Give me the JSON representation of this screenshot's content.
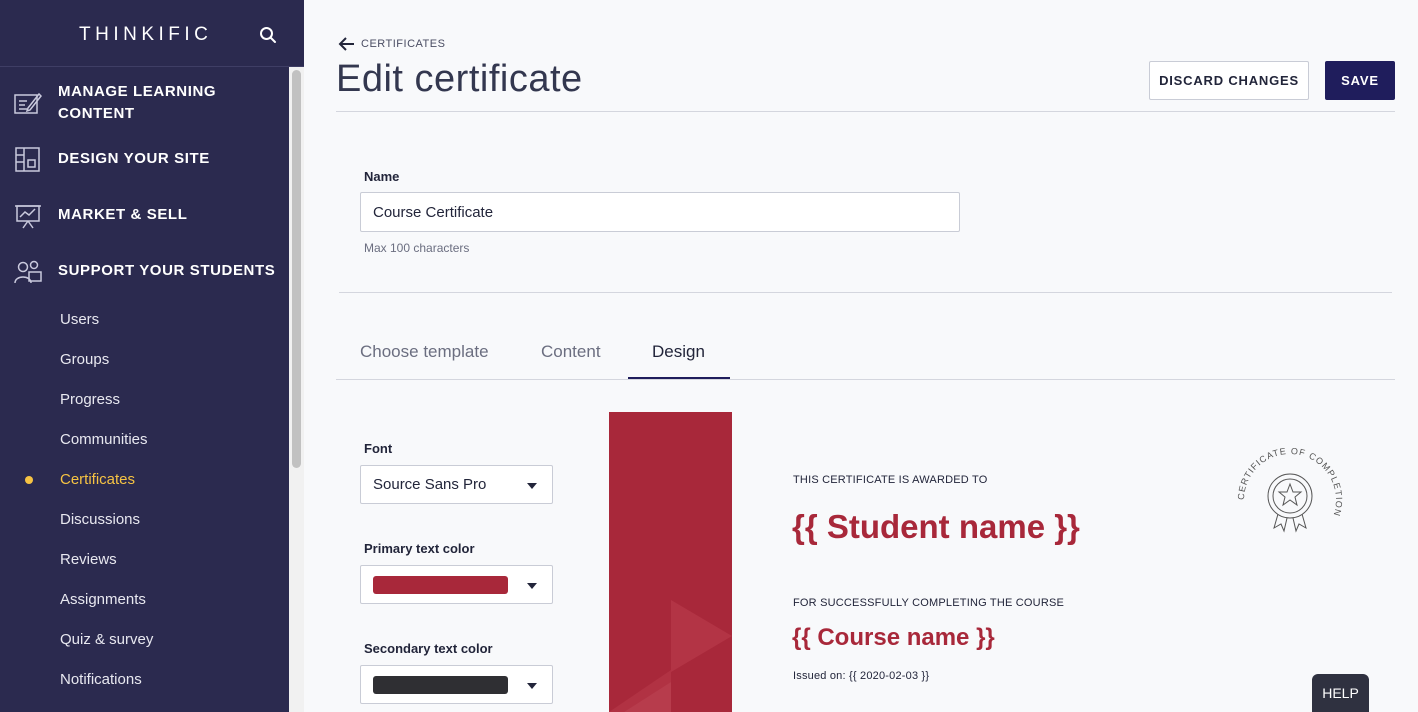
{
  "sidebar": {
    "brand": "THINKIFIC",
    "main_items": [
      {
        "label_line1": "MANAGE LEARNING",
        "label_line2": "CONTENT",
        "icon": "edit-content-icon"
      },
      {
        "label": "DESIGN YOUR SITE",
        "icon": "layout-icon"
      },
      {
        "label": "MARKET & SELL",
        "icon": "presentation-chart-icon"
      },
      {
        "label": "SUPPORT YOUR STUDENTS",
        "icon": "users-group-icon"
      }
    ],
    "sub_items": [
      "Users",
      "Groups",
      "Progress",
      "Communities",
      "Certificates",
      "Discussions",
      "Reviews",
      "Assignments",
      "Quiz & survey",
      "Notifications"
    ],
    "active_sub": "Certificates"
  },
  "header": {
    "back_label": "CERTIFICATES",
    "title": "Edit certificate",
    "discard_label": "DISCARD CHANGES",
    "save_label": "SAVE"
  },
  "form": {
    "name_label": "Name",
    "name_value": "Course Certificate",
    "name_hint": "Max 100 characters"
  },
  "tabs": [
    {
      "label": "Choose template"
    },
    {
      "label": "Content"
    },
    {
      "label": "Design"
    }
  ],
  "active_tab": "Design",
  "design": {
    "font_label": "Font",
    "font_value": "Source Sans Pro",
    "primary_label": "Primary text color",
    "primary_color": "#a8283a",
    "secondary_label": "Secondary text color",
    "secondary_color": "#2f2f33"
  },
  "certificate": {
    "awarded_to": "THIS CERTIFICATE IS AWARDED TO",
    "student_name": "{{ Student name }}",
    "completing": "FOR SUCCESSFULLY COMPLETING THE COURSE",
    "course_name": "{{ Course name }}",
    "issued_on": "Issued on: {{ 2020-02-03 }}",
    "seal_text": "CERTIFICATE OF COMPLETION"
  },
  "help_label": "HELP",
  "colors": {
    "sidebar_bg": "#2b2a4f",
    "accent": "#f6c343",
    "primary_button": "#1f1d5c",
    "certificate_red": "#a8283a"
  }
}
